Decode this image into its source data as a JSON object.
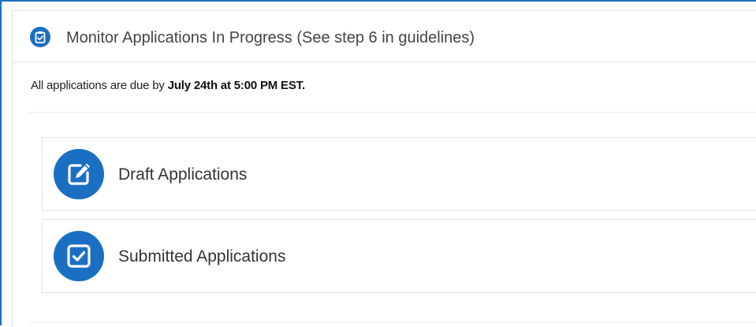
{
  "header": {
    "title": "Monitor Applications In Progress (See step 6 in guidelines)",
    "icon": "clipboard-check-icon"
  },
  "notice": {
    "prefix": "All applications are due by ",
    "deadline": "July 24th at 5:00 PM EST."
  },
  "cards": [
    {
      "label": "Draft Applications",
      "icon": "edit-icon"
    },
    {
      "label": "Submitted Applications",
      "icon": "checkbox-checked-icon"
    }
  ],
  "colors": {
    "accent": "#1b6fc2",
    "border": "#e4e4e4",
    "text": "#333333"
  }
}
